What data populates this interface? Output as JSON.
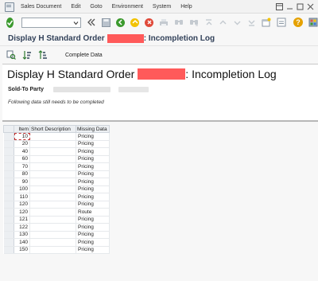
{
  "menu": {
    "items": [
      "Sales Document",
      "Edit",
      "Goto",
      "Environment",
      "System",
      "Help"
    ]
  },
  "title": {
    "prefix": "Display H Standard Order",
    "suffix": ": Incompletion Log"
  },
  "app_toolbar": {
    "complete_data_label": "Complete Data"
  },
  "header": {
    "title_prefix": "Display H Standard Order",
    "title_suffix": ": Incompletion Log",
    "sold_to_label": "Sold-To Party",
    "note": "Following data still needs to be completed"
  },
  "grid": {
    "columns": [
      "Item",
      "Short Description",
      "Missing Data"
    ],
    "rows": [
      {
        "item": "10",
        "desc": "",
        "missing": "Pricing"
      },
      {
        "item": "20",
        "desc": "",
        "missing": "Pricing"
      },
      {
        "item": "40",
        "desc": "",
        "missing": "Pricing"
      },
      {
        "item": "60",
        "desc": "",
        "missing": "Pricing"
      },
      {
        "item": "70",
        "desc": "",
        "missing": "Pricing"
      },
      {
        "item": "80",
        "desc": "",
        "missing": "Pricing"
      },
      {
        "item": "90",
        "desc": "",
        "missing": "Pricing"
      },
      {
        "item": "100",
        "desc": "",
        "missing": "Pricing"
      },
      {
        "item": "110",
        "desc": "",
        "missing": "Pricing"
      },
      {
        "item": "120",
        "desc": "",
        "missing": "Pricing"
      },
      {
        "item": "120",
        "desc": "",
        "missing": "Route"
      },
      {
        "item": "121",
        "desc": "",
        "missing": "Pricing"
      },
      {
        "item": "122",
        "desc": "",
        "missing": "Pricing"
      },
      {
        "item": "130",
        "desc": "",
        "missing": "Pricing"
      },
      {
        "item": "140",
        "desc": "",
        "missing": "Pricing"
      },
      {
        "item": "150",
        "desc": "",
        "missing": "Pricing"
      }
    ]
  },
  "colors": {
    "title": "#33425a",
    "ok_green": "#3c9a2e",
    "redaction": "#ff5a5a",
    "help_orange": "#e5a100"
  }
}
